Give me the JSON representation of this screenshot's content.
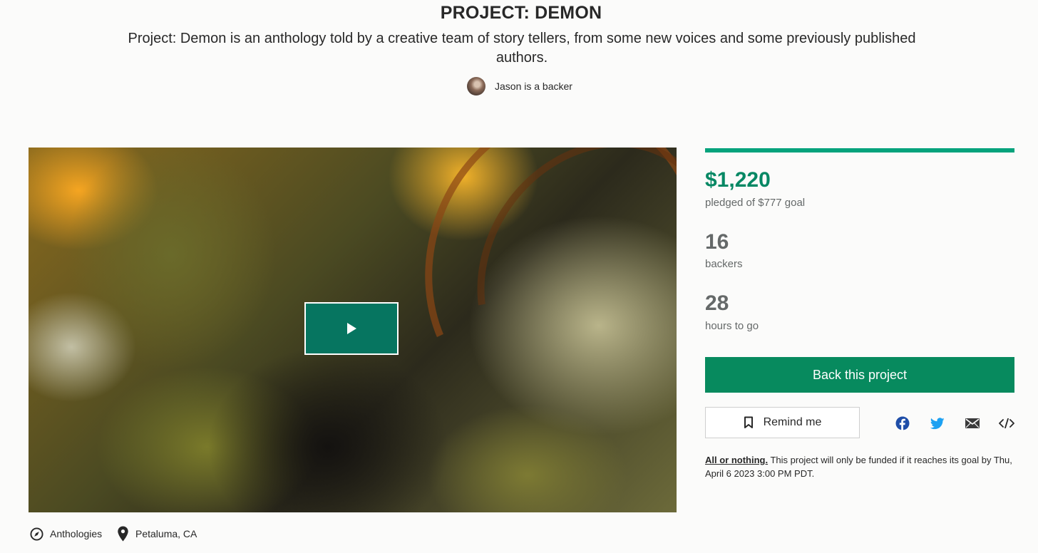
{
  "project": {
    "title": "PROJECT: DEMON",
    "blurb": "Project: Demon is an anthology told by a creative team of story tellers, from some new voices and some previously published authors.",
    "backer_note": "Jason is a backer"
  },
  "stats": {
    "pledged": "$1,220",
    "pledged_label": "pledged of $777 goal",
    "funding_progress": 1.0,
    "backers": "16",
    "backers_label": "backers",
    "time_left": "28",
    "time_left_label": "hours to go"
  },
  "actions": {
    "back_label": "Back this project",
    "remind_label": "Remind me",
    "share_icons": [
      "facebook-icon",
      "twitter-icon",
      "email-icon",
      "embed-icon"
    ]
  },
  "funding_note": {
    "link": "All or nothing.",
    "text": " This project will only be funded if it reaches its goal by Thu, April 6 2023 3:00 PM PDT."
  },
  "meta": {
    "category": "Anthologies",
    "location": "Petaluma, CA"
  },
  "colors": {
    "accent_green": "#05a37c",
    "button_green": "#078a5e",
    "play_button": "#067560",
    "facebook_blue": "#1f4ea8",
    "twitter_blue": "#1da1f2"
  }
}
